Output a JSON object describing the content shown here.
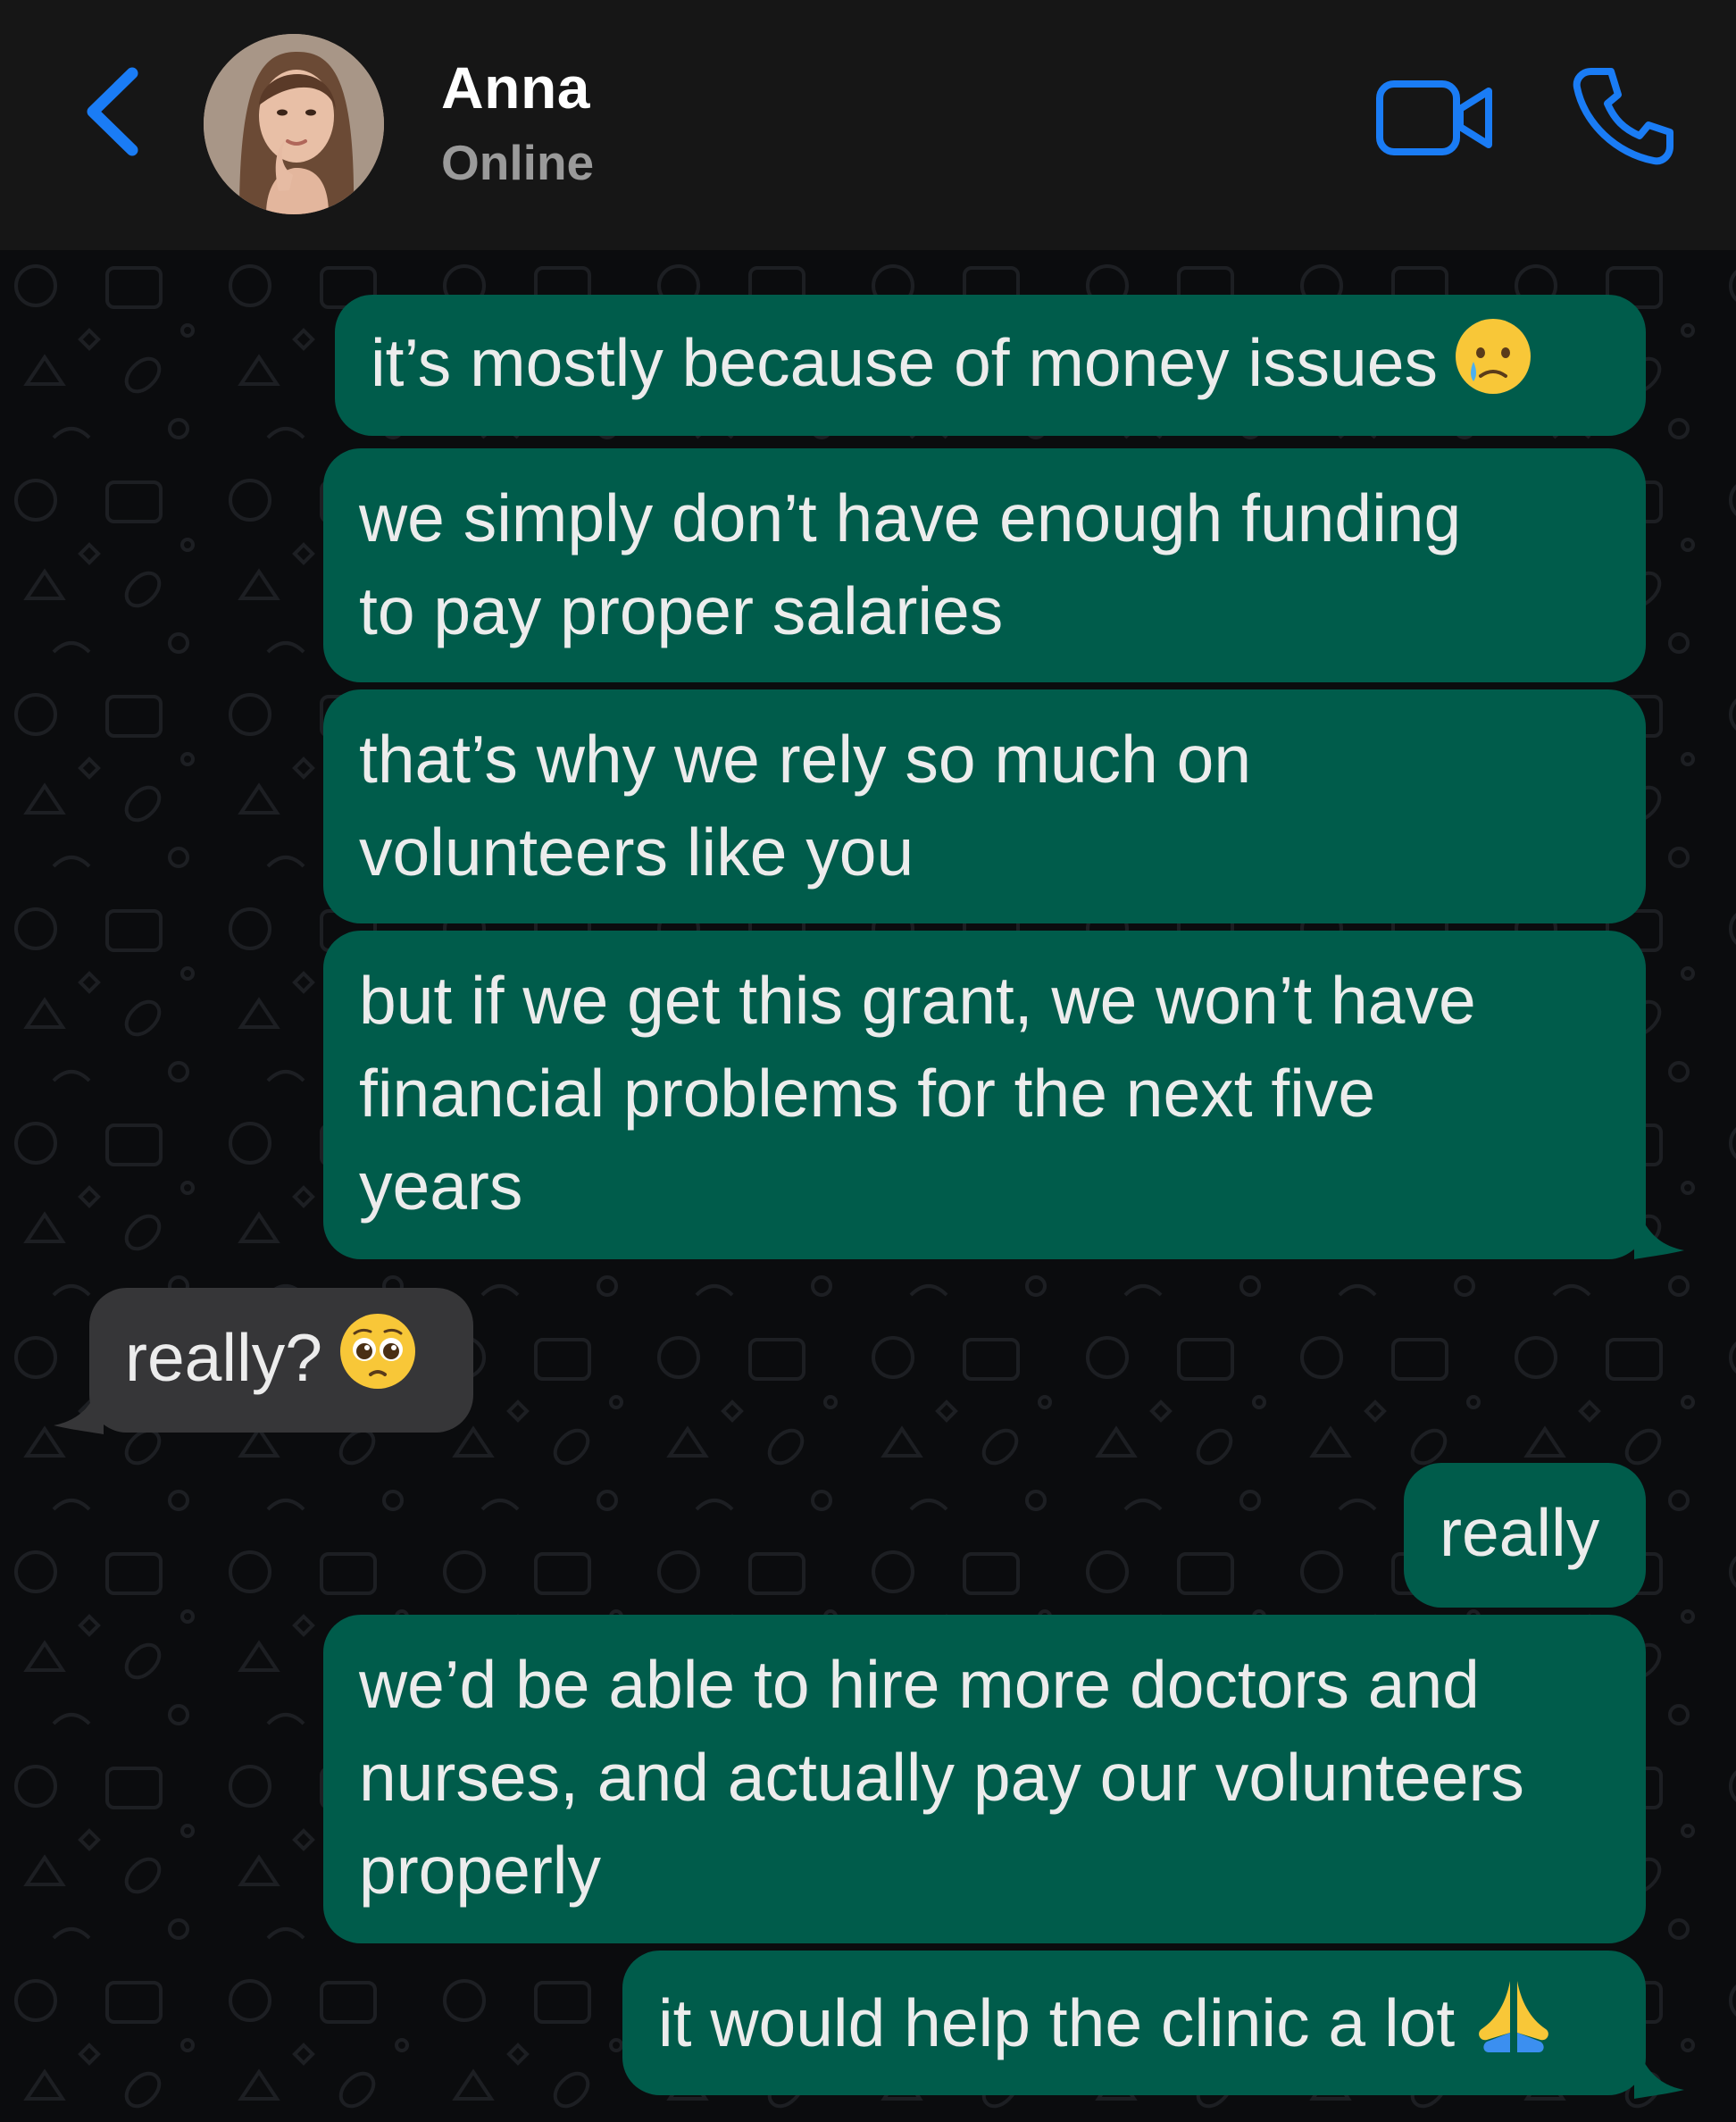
{
  "header": {
    "contact_name": "Anna",
    "contact_status": "Online",
    "accent_color": "#1a7cf5"
  },
  "messages": [
    {
      "direction": "outgoing",
      "text": "it’s mostly because of money issues",
      "emoji": "crying-face"
    },
    {
      "direction": "outgoing",
      "lines": [
        "we simply don’t have enough funding",
        "to pay proper salaries"
      ]
    },
    {
      "direction": "outgoing",
      "lines": [
        "that’s why we rely so much on",
        "volunteers like you"
      ]
    },
    {
      "direction": "outgoing",
      "lines": [
        "but if we get this grant, we won’t have",
        "financial problems for the next five",
        "years"
      ]
    },
    {
      "direction": "incoming",
      "text": "really?",
      "emoji": "pleading-face"
    },
    {
      "direction": "outgoing",
      "text": "really"
    },
    {
      "direction": "outgoing",
      "lines": [
        "we’d be able to hire more doctors and",
        "nurses, and actually pay our volunteers",
        "properly"
      ]
    },
    {
      "direction": "outgoing",
      "text": "it would help the clinic a lot",
      "emoji": "folded-hands"
    }
  ],
  "colors": {
    "outgoing_bubble": "#005c4b",
    "incoming_bubble": "#363638",
    "header_bg": "#161616",
    "chat_bg": "#0b0c0e"
  }
}
